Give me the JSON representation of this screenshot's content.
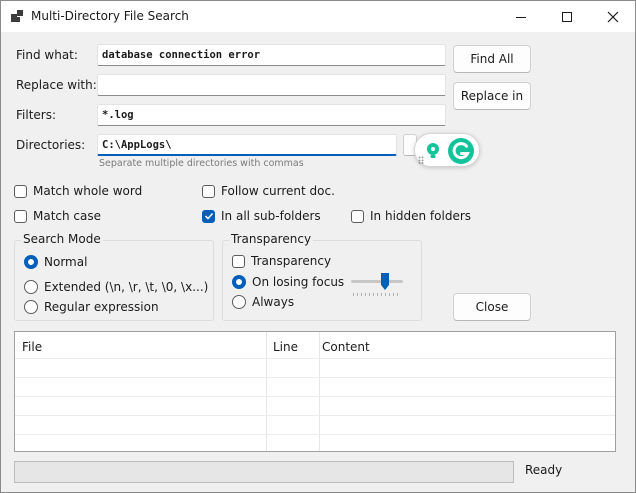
{
  "window": {
    "title": "Multi-Directory File Search",
    "controls": {
      "minimize": "minimize-icon",
      "maximize": "maximize-icon",
      "close": "close-icon"
    }
  },
  "form": {
    "find_label": "Find what:",
    "find_value": "database connection error",
    "replace_label": "Replace with:",
    "replace_value": "",
    "filters_label": "Filters:",
    "filters_value": "*.log",
    "directories_label": "Directories:",
    "directories_value": "C:\\AppLogs\\",
    "directories_hint": "Separate multiple directories with commas"
  },
  "buttons": {
    "find_all": "Find All",
    "replace_in": "Replace in",
    "close": "Close"
  },
  "options": {
    "match_whole_word": {
      "label": "Match whole word",
      "checked": false
    },
    "match_case": {
      "label": "Match case",
      "checked": false
    },
    "follow_current_doc": {
      "label": "Follow current doc.",
      "checked": false
    },
    "in_all_subfolders": {
      "label": "In all sub-folders",
      "checked": true
    },
    "in_hidden_folders": {
      "label": "In hidden folders",
      "checked": false
    }
  },
  "search_mode": {
    "title": "Search Mode",
    "options": [
      {
        "label": "Normal",
        "selected": true
      },
      {
        "label": "Extended (\\n, \\r, \\t, \\0, \\x...)",
        "selected": false
      },
      {
        "label": "Regular expression",
        "selected": false
      }
    ]
  },
  "transparency": {
    "title": "Transparency",
    "enable_label": "Transparency",
    "enable_checked": false,
    "on_losing_focus": "On losing focus",
    "always": "Always",
    "selected": "On losing focus",
    "slider_level": 0.7
  },
  "results": {
    "columns": [
      "File",
      "Line",
      "Content"
    ]
  },
  "status": {
    "text": "Ready",
    "progress": 0
  },
  "colors": {
    "accent": "#005fb8",
    "grammarly": "#15c39a"
  }
}
